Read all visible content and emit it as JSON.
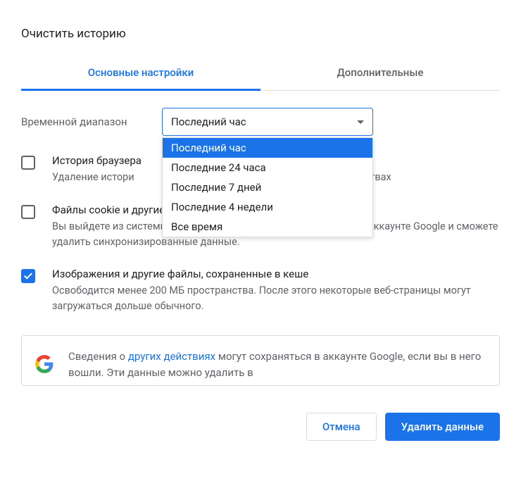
{
  "title": "Очистить историю",
  "tabs": {
    "basic": "Основные настройки",
    "advanced": "Дополнительные"
  },
  "time_range": {
    "label": "Временной диапазон",
    "selected": "Последний час",
    "options": [
      "Последний час",
      "Последние 24 часа",
      "Последние 7 дней",
      "Последние 4 недели",
      "Все время"
    ]
  },
  "items": [
    {
      "checked": false,
      "title": "История браузера",
      "desc_before": "Удаление истори",
      "desc_after": "стройствах"
    },
    {
      "checked": false,
      "title": "Файлы cookie и другие данные сайтов",
      "desc": "Вы выйдете из системы на большинстве сайтов, но останетесь в аккаунте Google и сможете удалить синхронизированные данные."
    },
    {
      "checked": true,
      "title": "Изображения и другие файлы, сохраненные в кеше",
      "desc": "Освободится менее 200 МБ пространства. После этого некоторые веб-страницы могут загружаться дольше обычного."
    }
  ],
  "info": {
    "prefix": "Сведения о ",
    "link": "других действиях",
    "suffix": " могут сохраняться в аккаунте Google, если вы в него вошли. Эти данные можно удалить в"
  },
  "buttons": {
    "cancel": "Отмена",
    "confirm": "Удалить данные"
  }
}
